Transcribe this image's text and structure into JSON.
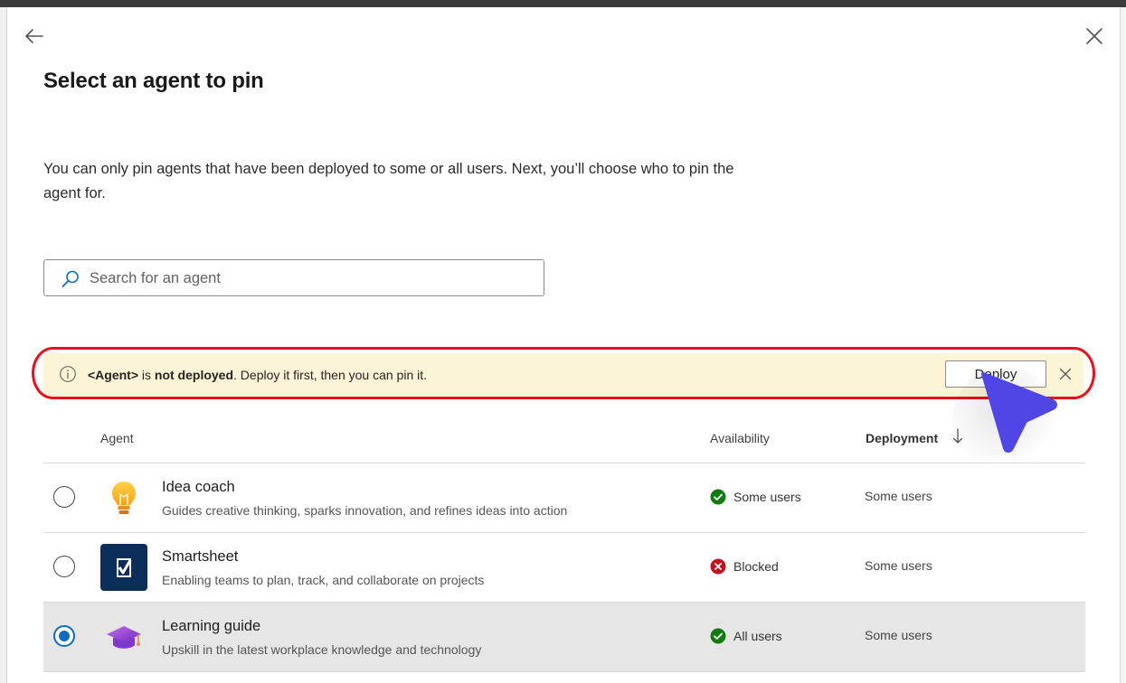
{
  "title": "Select an agent to pin",
  "description": "You can only pin agents that have been deployed to some or all users. Next, you’ll choose who to pin the agent for.",
  "search": {
    "placeholder": "Search for an agent"
  },
  "banner": {
    "agent": "<Agent>",
    "is_text": " is ",
    "status": "not deployed",
    "suffix": ". Deploy it first, then you can pin it.",
    "deploy_label": "Deploy"
  },
  "table": {
    "headers": {
      "agent": "Agent",
      "availability": "Availability",
      "deployment": "Deployment"
    },
    "sort_column": "Deployment",
    "sort_direction": "descending",
    "rows": [
      {
        "name": "Idea coach",
        "description": "Guides creative thinking, sparks innovation, and refines ideas into action",
        "availability": "Some users",
        "availability_status": "allowed",
        "deployment": "Some users",
        "icon": "lightbulb-icon",
        "selected": false
      },
      {
        "name": "Smartsheet",
        "description": "Enabling teams to plan, track, and collaborate on projects",
        "availability": "Blocked",
        "availability_status": "blocked",
        "deployment": "Some users",
        "icon": "smartsheet-logo-icon",
        "selected": false
      },
      {
        "name": "Learning guide",
        "description": "Upskill in the latest workplace knowledge and technology",
        "availability": "All users",
        "availability_status": "allowed",
        "deployment": "Some users",
        "icon": "graduation-cap-icon",
        "selected": true
      }
    ]
  },
  "colors": {
    "banner_bg": "#fcf4d6",
    "highlight_outline": "#e8101c",
    "status_allowed": "#107c10",
    "status_blocked": "#c50f1f",
    "radio_selected": "#0f6cbd",
    "cursor": "#4f46e5"
  }
}
